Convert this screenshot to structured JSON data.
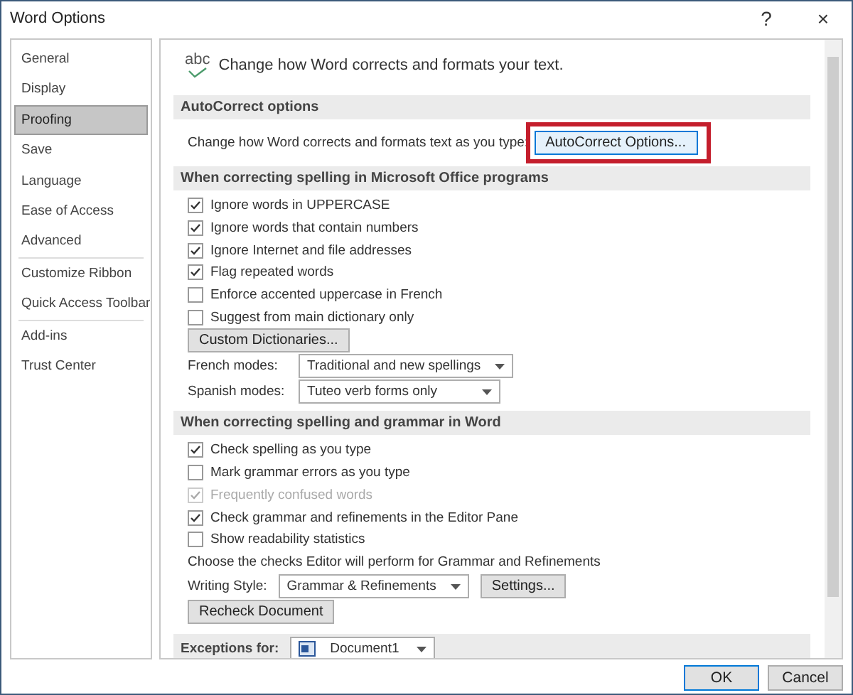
{
  "window": {
    "title": "Word Options",
    "help": "?",
    "close": "×"
  },
  "sidebar": {
    "groups": [
      [
        {
          "label": "General",
          "selected": false
        },
        {
          "label": "Display",
          "selected": false
        },
        {
          "label": "Proofing",
          "selected": true
        },
        {
          "label": "Save",
          "selected": false
        },
        {
          "label": "Language",
          "selected": false
        },
        {
          "label": "Ease of Access",
          "selected": false
        },
        {
          "label": "Advanced",
          "selected": false
        }
      ],
      [
        {
          "label": "Customize Ribbon",
          "selected": false
        },
        {
          "label": "Quick Access Toolbar",
          "selected": false
        }
      ],
      [
        {
          "label": "Add-ins",
          "selected": false
        },
        {
          "label": "Trust Center",
          "selected": false
        }
      ]
    ]
  },
  "header": {
    "icon_text": "abc",
    "text": "Change how Word corrects and formats your text."
  },
  "sections": [
    {
      "title": "AutoCorrect options",
      "items": [
        {
          "kind": "button-row",
          "label": "Change how Word corrects and formats text as you type:",
          "button": "AutoCorrect Options...",
          "highlighted": true
        }
      ]
    },
    {
      "title": "When correcting spelling in Microsoft Office programs",
      "items": [
        {
          "kind": "checkbox",
          "label": "Ignore words in UPPERCASE",
          "checked": true,
          "disabled": false
        },
        {
          "kind": "checkbox",
          "label": "Ignore words that contain numbers",
          "checked": true,
          "disabled": false
        },
        {
          "kind": "checkbox",
          "label": "Ignore Internet and file addresses",
          "checked": true,
          "disabled": false
        },
        {
          "kind": "checkbox",
          "label": "Flag repeated words",
          "checked": true,
          "disabled": false
        },
        {
          "kind": "checkbox",
          "label": "Enforce accented uppercase in French",
          "checked": false,
          "disabled": false
        },
        {
          "kind": "checkbox",
          "label": "Suggest from main dictionary only",
          "checked": false,
          "disabled": false
        },
        {
          "kind": "button",
          "label": "Custom Dictionaries..."
        },
        {
          "kind": "dropdown",
          "label": "French modes:",
          "value": "Traditional and new spellings"
        },
        {
          "kind": "dropdown",
          "label": "Spanish modes:",
          "value": "Tuteo verb forms only"
        }
      ]
    },
    {
      "title": "When correcting spelling and grammar in Word",
      "items": [
        {
          "kind": "checkbox",
          "label": "Check spelling as you type",
          "checked": true,
          "disabled": false
        },
        {
          "kind": "checkbox",
          "label": "Mark grammar errors as you type",
          "checked": false,
          "disabled": false
        },
        {
          "kind": "checkbox",
          "label": "Frequently confused words",
          "checked": true,
          "disabled": true
        },
        {
          "kind": "checkbox",
          "label": "Check grammar and refinements in the Editor Pane",
          "checked": true,
          "disabled": false
        },
        {
          "kind": "checkbox",
          "label": "Show readability statistics",
          "checked": false,
          "disabled": false
        },
        {
          "kind": "text",
          "label": "Choose the checks Editor will perform for Grammar and Refinements"
        },
        {
          "kind": "dropdown-button",
          "label": "Writing Style:",
          "value": "Grammar & Refinements",
          "button": "Settings..."
        },
        {
          "kind": "button",
          "label": "Recheck Document"
        }
      ]
    }
  ],
  "exceptions": {
    "label": "Exceptions for:",
    "value": "Document1"
  },
  "buttons": [
    {
      "label": "OK",
      "default": true
    },
    {
      "label": "Cancel",
      "default": false
    }
  ]
}
